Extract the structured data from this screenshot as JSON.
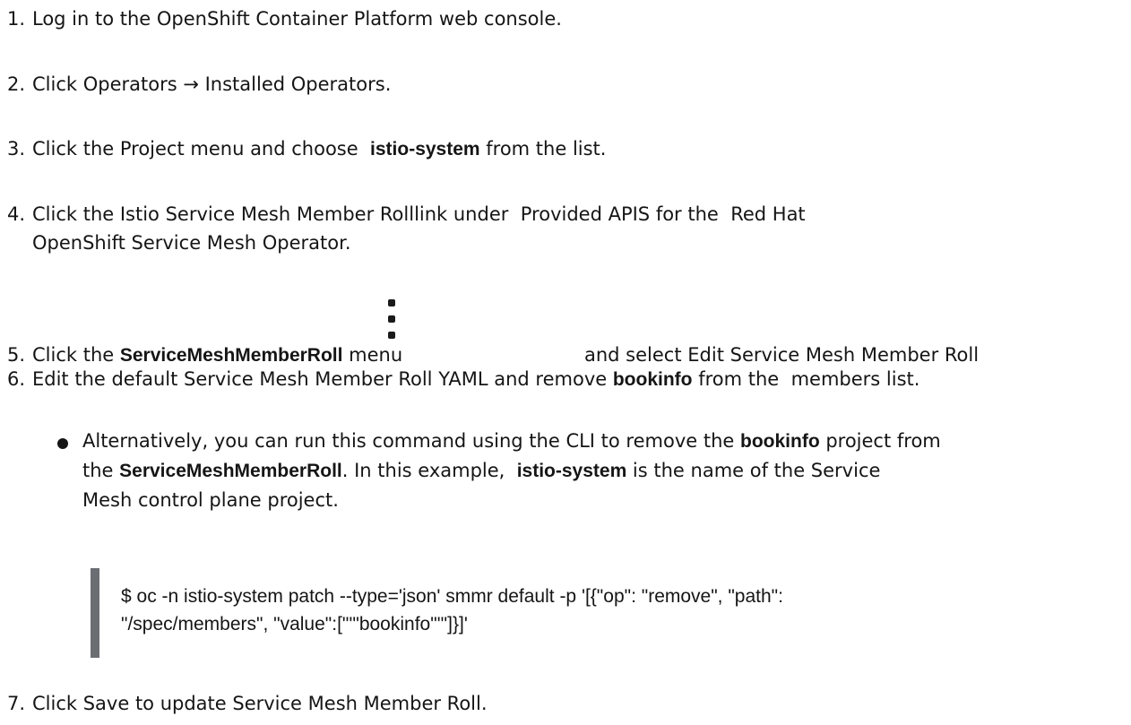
{
  "steps": [
    {
      "num": "1.",
      "text": "Log in to the OpenShift Container Platform web console."
    },
    {
      "num": "2.",
      "pre": "Click ",
      "bold": "Operators → Installed Operators",
      "post": "."
    },
    {
      "num": "3.",
      "pre": "Click the ",
      "bold1": "Project",
      "mid": " menu and choose ",
      "bold2": "istio-system",
      "post": " from the list."
    },
    {
      "num": "4.",
      "pre": "Click the ",
      "bold1": "Istio Service Mesh Member Roll",
      "mid1": "link under ",
      "bold2": "Provided APIS",
      "mid2": " for the ",
      "bold3": "Red Hat",
      "bold4": "OpenShift Service Mesh",
      "post": " Operator."
    },
    {
      "num": "5.",
      "pre": "Click the ",
      "bold1": "ServiceMeshMemberRoll",
      "mid": " menu",
      "mid2": "and select ",
      "bold2": "Edit Service Mesh Member Roll"
    },
    {
      "num": "6.",
      "pre": "Edit the default Service Mesh Member Roll YAML and remove ",
      "bold1": "bookinfo",
      "mid": " from the ",
      "bold2": "members",
      "post": " list."
    },
    {
      "num": "7.",
      "pre": "Click ",
      "bold": "Save",
      "post": " to update Service Mesh Member Roll."
    }
  ],
  "bullet": {
    "pre": "Alternatively, you can run this command using the CLI to remove the ",
    "bold1": "bookinfo",
    "mid1": " project from",
    "line2_pre": "the ",
    "bold2": "ServiceMeshMemberRoll",
    "mid2": ". In this example, ",
    "bold3": "istio-system",
    "mid3": " is the name of the Service",
    "line3": "Mesh control plane project."
  },
  "code": {
    "line1": "$ oc -n istio-system patch --type='json' smmr default -p '[{\"op\": \"remove\", \"path\":",
    "line2": "\"/spec/members\", \"value\":[\"'\"bookinfo\"'\"]}]'"
  },
  "icons": {
    "kebab": "kebab-menu-icon"
  }
}
